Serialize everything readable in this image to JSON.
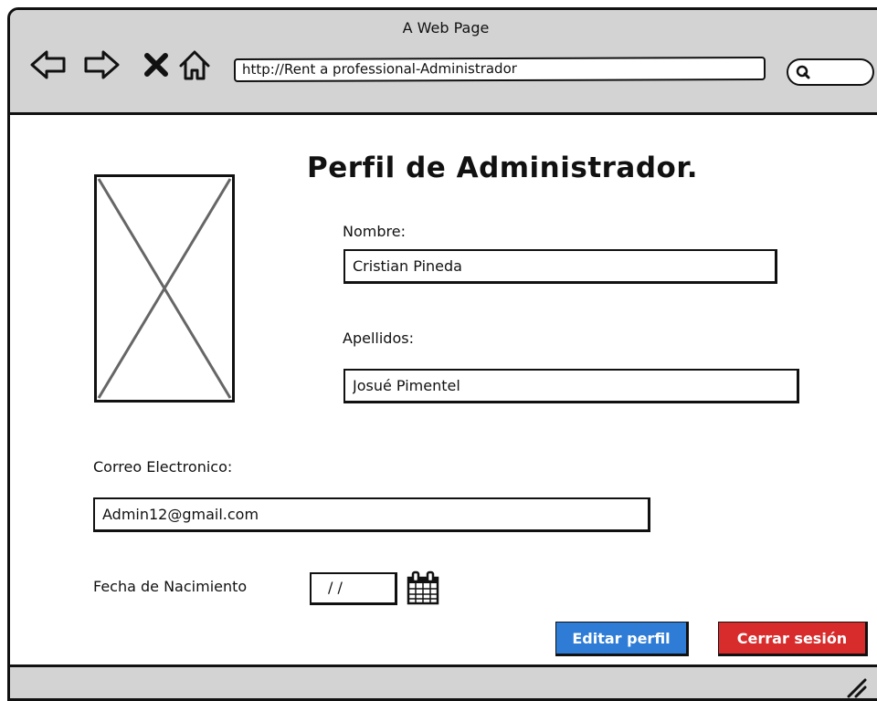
{
  "window": {
    "title": "A Web Page",
    "url": "http://Rent a professional-Administrador"
  },
  "toolbar": {
    "icons": [
      "back-arrow-icon",
      "forward-arrow-icon",
      "close-x-icon",
      "home-icon",
      "search-icon"
    ]
  },
  "profile": {
    "heading": "Perfil de Administrador.",
    "image_placeholder": "image-placeholder",
    "nombre": {
      "label": "Nombre:",
      "value": "Cristian Pineda"
    },
    "apellidos": {
      "label": "Apellidos:",
      "value": "Josué Pimentel"
    },
    "correo": {
      "label": "Correo Electronico:",
      "value": "Admin12@gmail.com"
    },
    "fecha": {
      "label": "Fecha de Nacimiento",
      "value": "/ /"
    }
  },
  "actions": {
    "edit_label": "Editar perfil",
    "edit_color": "#2e7cd6",
    "logout_label": "Cerrar sesión",
    "logout_color": "#d82b2b"
  }
}
